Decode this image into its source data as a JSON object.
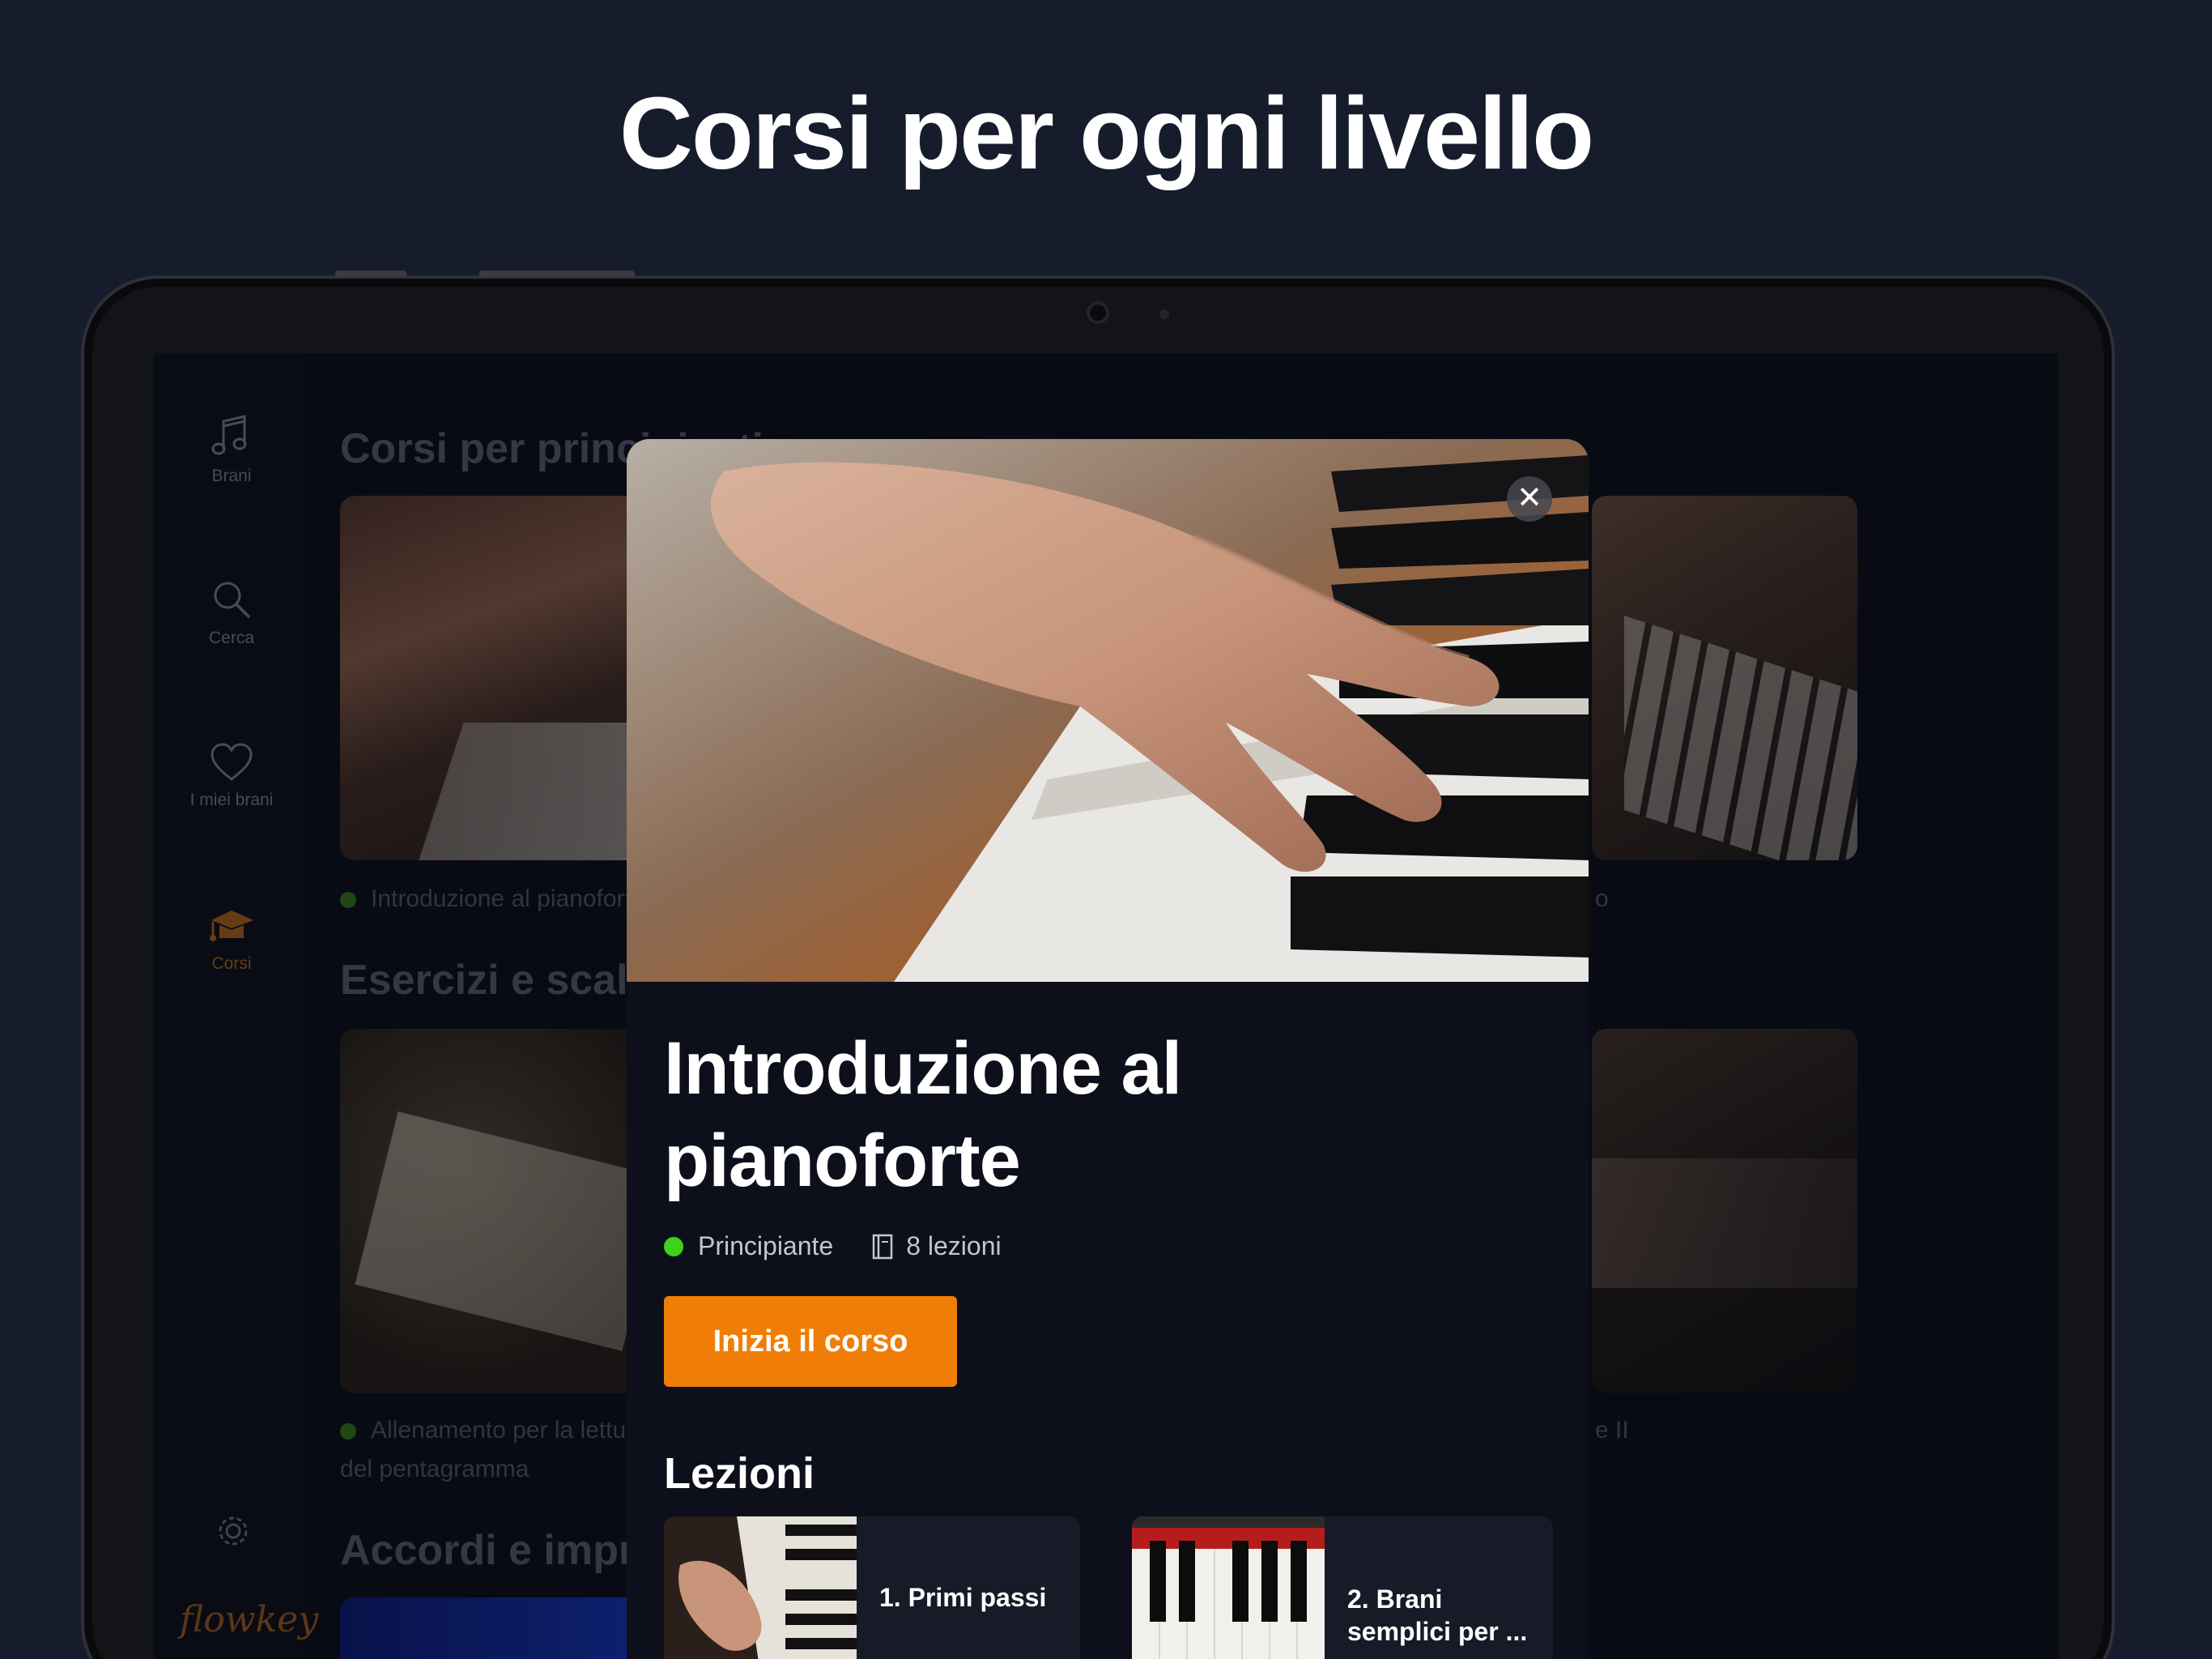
{
  "headline": "Corsi per ogni livello",
  "sidebar": {
    "items": [
      {
        "label": "Brani",
        "icon": "music-note-icon"
      },
      {
        "label": "Cerca",
        "icon": "search-icon"
      },
      {
        "label": "I miei brani",
        "icon": "heart-icon"
      },
      {
        "label": "Corsi",
        "icon": "graduation-cap-icon",
        "active": true
      }
    ],
    "settings_icon": "gear-icon",
    "logo": "flowkey"
  },
  "sections": [
    {
      "title": "Corsi per principianti",
      "cards": [
        {
          "label": "Introduzione al pianoforte"
        },
        {
          "label": "o"
        }
      ]
    },
    {
      "title": "Esercizi e scale",
      "cards": [
        {
          "label": "Allenamento per la lettura del pentagramma"
        },
        {
          "label": "e II"
        }
      ]
    },
    {
      "title": "Accordi e improvvisazione"
    }
  ],
  "modal": {
    "title": "Introduzione al pianoforte",
    "level": "Principiante",
    "lessons_count": "8 lezioni",
    "cta": "Inizia il corso",
    "lessons_heading": "Lezioni",
    "lessons": [
      {
        "label": "1. Primi passi"
      },
      {
        "label": "2. Brani semplici per ..."
      }
    ]
  },
  "colors": {
    "accent": "#f07e06",
    "level_green": "#3fd21c",
    "background": "#161c2c"
  }
}
